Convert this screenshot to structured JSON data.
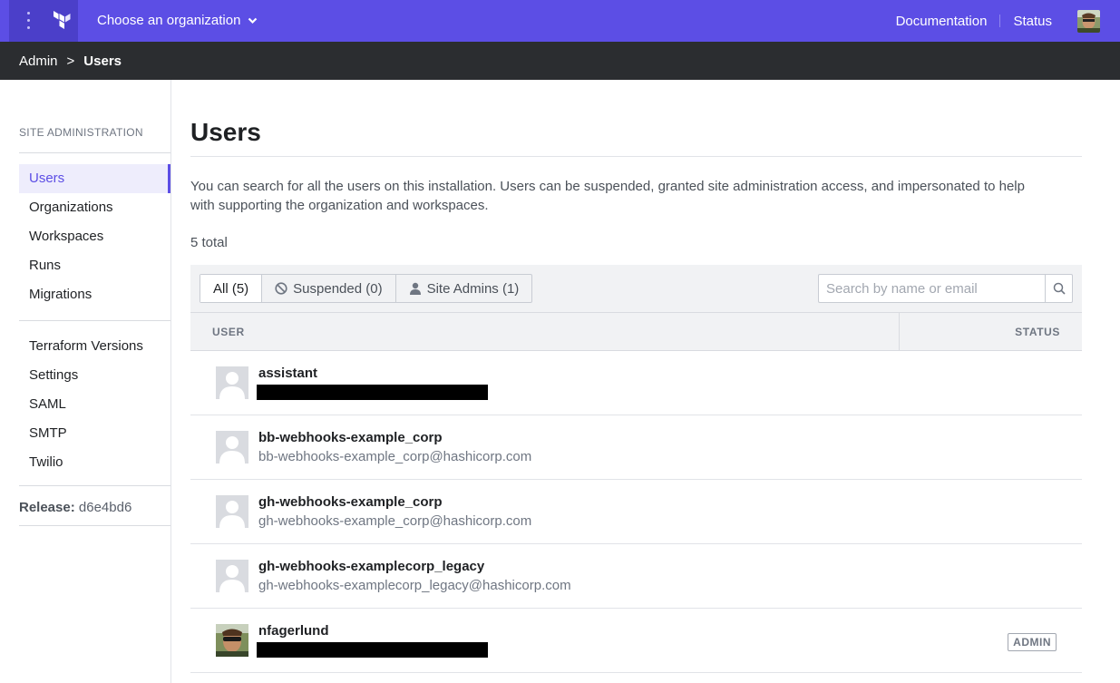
{
  "topbar": {
    "org_switcher_label": "Choose an organization",
    "links": {
      "documentation": "Documentation",
      "status": "Status"
    },
    "brand_color": "#5c4ee5"
  },
  "breadcrumb": {
    "parent": "Admin",
    "separator": ">",
    "current": "Users"
  },
  "sidebar": {
    "heading": "SITE ADMINISTRATION",
    "group1": [
      {
        "label": "Users",
        "active": true
      },
      {
        "label": "Organizations"
      },
      {
        "label": "Workspaces"
      },
      {
        "label": "Runs"
      },
      {
        "label": "Migrations"
      }
    ],
    "group2": [
      {
        "label": "Terraform Versions"
      },
      {
        "label": "Settings"
      },
      {
        "label": "SAML"
      },
      {
        "label": "SMTP"
      },
      {
        "label": "Twilio"
      }
    ],
    "release_label": "Release:",
    "release_value": "d6e4bd6"
  },
  "main": {
    "title": "Users",
    "description": "You can search for all the users on this installation. Users can be suspended, granted site administration access, and impersonated to help with supporting the organization and workspaces.",
    "total": "5 total",
    "tabs": [
      {
        "label": "All (5)",
        "icon": "none"
      },
      {
        "label": "Suspended (0)",
        "icon": "ban-icon"
      },
      {
        "label": "Site Admins (1)",
        "icon": "person-icon"
      }
    ],
    "search_placeholder": "Search by name or email",
    "columns": {
      "user": "USER",
      "status": "STATUS"
    },
    "users": [
      {
        "username": "assistant",
        "email": "",
        "email_redacted": true,
        "status": "",
        "avatar": "default"
      },
      {
        "username": "bb-webhooks-example_corp",
        "email": "bb-webhooks-example_corp@hashicorp.com",
        "email_redacted": false,
        "status": "",
        "avatar": "default"
      },
      {
        "username": "gh-webhooks-example_corp",
        "email": "gh-webhooks-example_corp@hashicorp.com",
        "email_redacted": false,
        "status": "",
        "avatar": "default"
      },
      {
        "username": "gh-webhooks-examplecorp_legacy",
        "email": "gh-webhooks-examplecorp_legacy@hashicorp.com",
        "email_redacted": false,
        "status": "",
        "avatar": "default"
      },
      {
        "username": "nfagerlund",
        "email": "",
        "email_redacted": true,
        "status": "ADMIN",
        "avatar": "photo"
      }
    ]
  }
}
